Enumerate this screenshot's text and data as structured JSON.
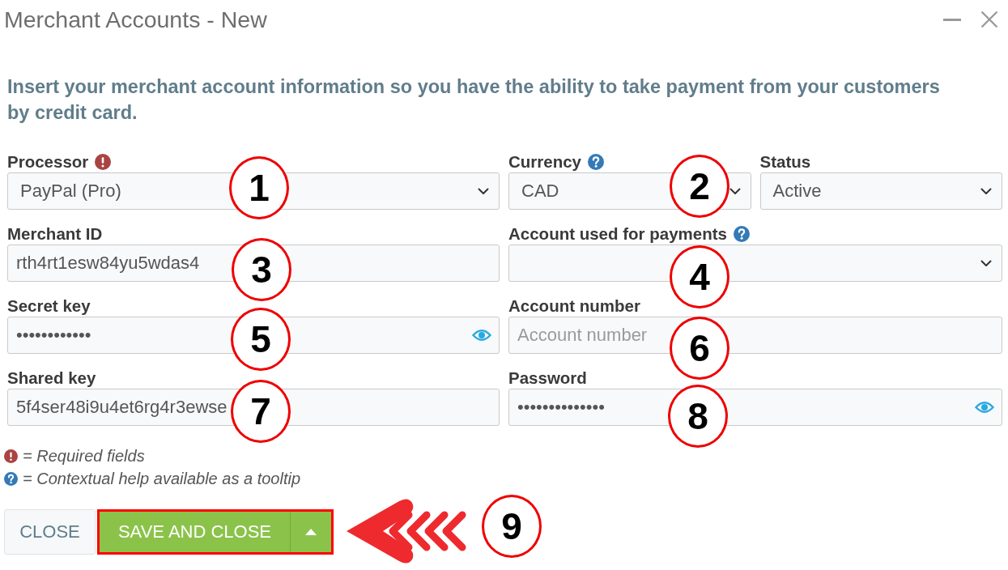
{
  "window": {
    "title": "Merchant Accounts - New"
  },
  "intro": "Insert your merchant account information so you have the ability to take payment from your customers by credit card.",
  "form": {
    "rows": [
      {
        "fields": [
          {
            "kind": "select",
            "label": "Processor",
            "required": true,
            "help": false,
            "value": "PayPal (Pro)"
          },
          {
            "kind": "select",
            "label": "Currency",
            "required": false,
            "help": true,
            "value": "CAD"
          },
          {
            "kind": "select",
            "label": "Status",
            "required": false,
            "help": false,
            "value": "Active"
          }
        ]
      },
      {
        "fields": [
          {
            "kind": "text",
            "label": "Merchant ID",
            "required": false,
            "help": false,
            "value": "rth4rt1esw84yu5wdas4"
          },
          {
            "kind": "select",
            "label": "Account used for payments",
            "required": false,
            "help": true
          }
        ]
      },
      {
        "fields": [
          {
            "kind": "password",
            "label": "Secret key",
            "required": false,
            "help": false,
            "value": "••••••••••••"
          },
          {
            "kind": "text",
            "label": "Account number",
            "required": false,
            "help": false,
            "placeholder": "Account number"
          }
        ]
      },
      {
        "fields": [
          {
            "kind": "text",
            "label": "Shared key",
            "required": false,
            "help": false,
            "value": "5f4ser48i9u4et6rg4r3ewse"
          },
          {
            "kind": "password",
            "label": "Password",
            "required": false,
            "help": false,
            "value": "••••••••••••••"
          }
        ]
      }
    ]
  },
  "legend": [
    {
      "kind": "required",
      "text": "= Required fields"
    },
    {
      "kind": "help",
      "text": "= Contextual help available as a tooltip"
    }
  ],
  "buttons": [
    {
      "kind": "plain",
      "label": "CLOSE",
      "highlighted": false
    },
    {
      "kind": "split",
      "label": "SAVE AND CLOSE",
      "highlighted": true
    }
  ],
  "callouts": [
    {
      "number": "1"
    },
    {
      "number": "2"
    },
    {
      "number": "3"
    },
    {
      "number": "4"
    },
    {
      "number": "5"
    },
    {
      "number": "6"
    },
    {
      "number": "7"
    },
    {
      "number": "8"
    },
    {
      "number": "9"
    }
  ]
}
